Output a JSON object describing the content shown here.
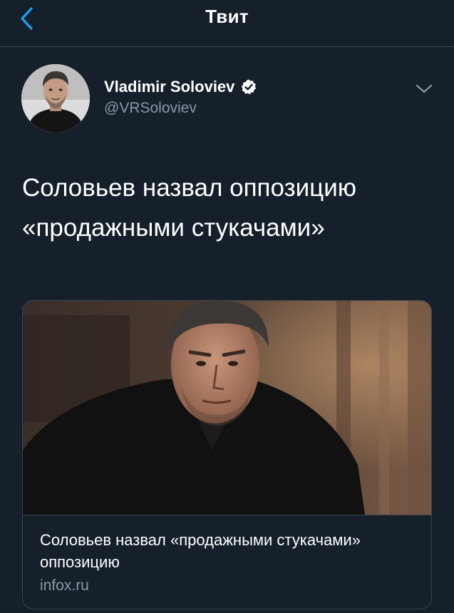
{
  "header": {
    "title": "Твит",
    "back_icon": "chevron-left-icon",
    "accent_color": "#1da1f2"
  },
  "author": {
    "name": "Vladimir Soloviev",
    "handle": "@VRSoloviev",
    "verified": true
  },
  "tweet": {
    "text": "Соловьев назвал оппозицию «продажными стукачами»"
  },
  "card": {
    "title": "Соловьев назвал «продажными стукачами» оппозицию",
    "domain": "infox.ru"
  },
  "colors": {
    "background": "#15202b",
    "border": "#38444d",
    "secondary_text": "#8899a6",
    "primary_text": "#ffffff"
  }
}
